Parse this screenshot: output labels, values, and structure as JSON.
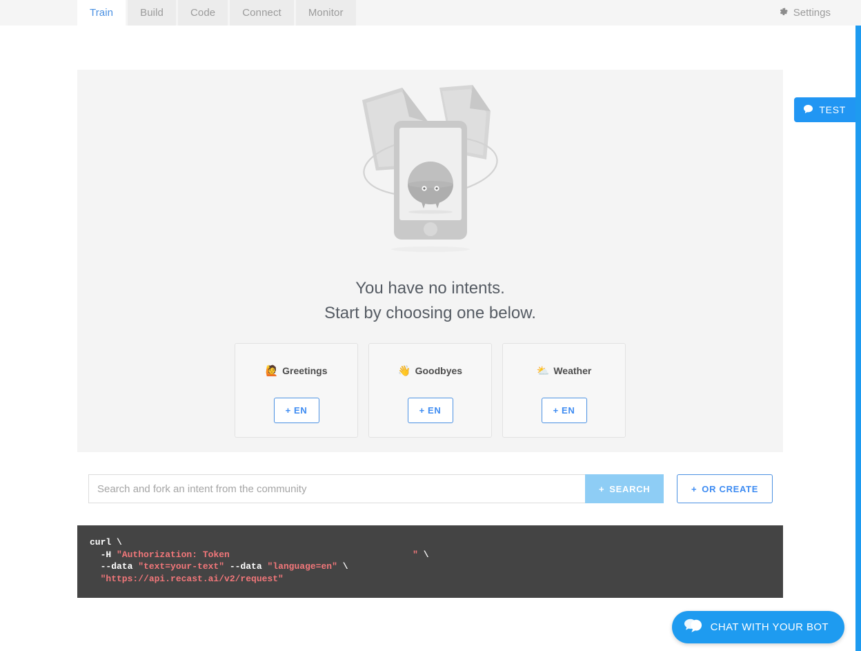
{
  "tabs": [
    {
      "label": "Train",
      "active": true
    },
    {
      "label": "Build",
      "active": false
    },
    {
      "label": "Code",
      "active": false
    },
    {
      "label": "Connect",
      "active": false
    },
    {
      "label": "Monitor",
      "active": false
    }
  ],
  "header": {
    "settings_label": "Settings",
    "settings_icon": "gear-icon"
  },
  "empty_state": {
    "line1": "You have no intents.",
    "line2": "Start by choosing one below.",
    "illustration_name": "no-intents-bot-illustration"
  },
  "intent_cards": [
    {
      "emoji": "🙋",
      "title": "Greetings",
      "button": "+ EN"
    },
    {
      "emoji": "👋",
      "title": "Goodbyes",
      "button": "+ EN"
    },
    {
      "emoji": "⛅",
      "title": "Weather",
      "button": "+ EN"
    }
  ],
  "search": {
    "placeholder": "Search and fork an intent from the community",
    "value": "",
    "search_button": "SEARCH",
    "search_plus": "+",
    "create_button": "OR CREATE",
    "create_plus": "+"
  },
  "code_block": {
    "line1_cmd": "curl ",
    "line1_slash": "\\",
    "line2_flag": "  -H ",
    "line2_str": "\"Authorization: Token                                  \"",
    "line2_slash": " \\",
    "line3_flag": "  --data ",
    "line3_str1": "\"text=your-text\"",
    "line3_flag2": " --data ",
    "line3_str2": "\"language=en\"",
    "line3_slash": " \\",
    "line4_str": "  \"https://api.recast.ai/v2/request\""
  },
  "test_tab": {
    "label": "TEST",
    "icon": "chat-bubble-icon"
  },
  "chat_button": {
    "label": "CHAT WITH YOUR BOT",
    "icon": "chat-bubbles-icon"
  },
  "colors": {
    "accent_blue": "#2196f3",
    "active_tab_text": "#4a90e2",
    "search_button_bg": "#8ecdf5",
    "code_bg": "#444444",
    "code_string": "#f2777a",
    "panel_bg": "#f4f4f4"
  }
}
